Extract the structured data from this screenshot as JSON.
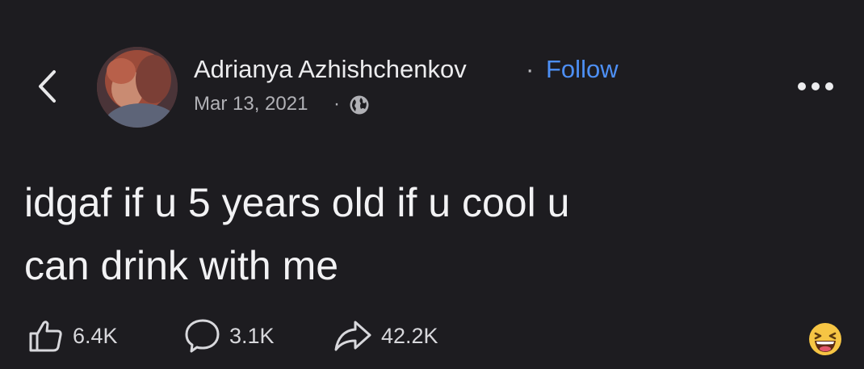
{
  "author": {
    "name": "Adrianya Azhishchenkov",
    "separator": "·",
    "follow_label": "Follow"
  },
  "post": {
    "date": "Mar 13, 2021",
    "date_separator": "·",
    "audience_icon": "globe-icon",
    "text_line_1": "idgaf if u 5 years old if u cool u",
    "text_line_2": "can drink with me"
  },
  "actions": {
    "likes": "6.4K",
    "comments": "3.1K",
    "shares": "42.2K"
  },
  "icons": {
    "back": "chevron-left-icon",
    "more": "more-dots-icon",
    "like": "thumbs-up-icon",
    "comment": "comment-bubble-icon",
    "share": "share-arrow-icon",
    "emoji": "laughing-emoji-icon"
  },
  "colors": {
    "background": "#1d1c20",
    "text": "#f2f2f4",
    "link": "#4d8ff5",
    "muted": "#b1b1b6"
  }
}
